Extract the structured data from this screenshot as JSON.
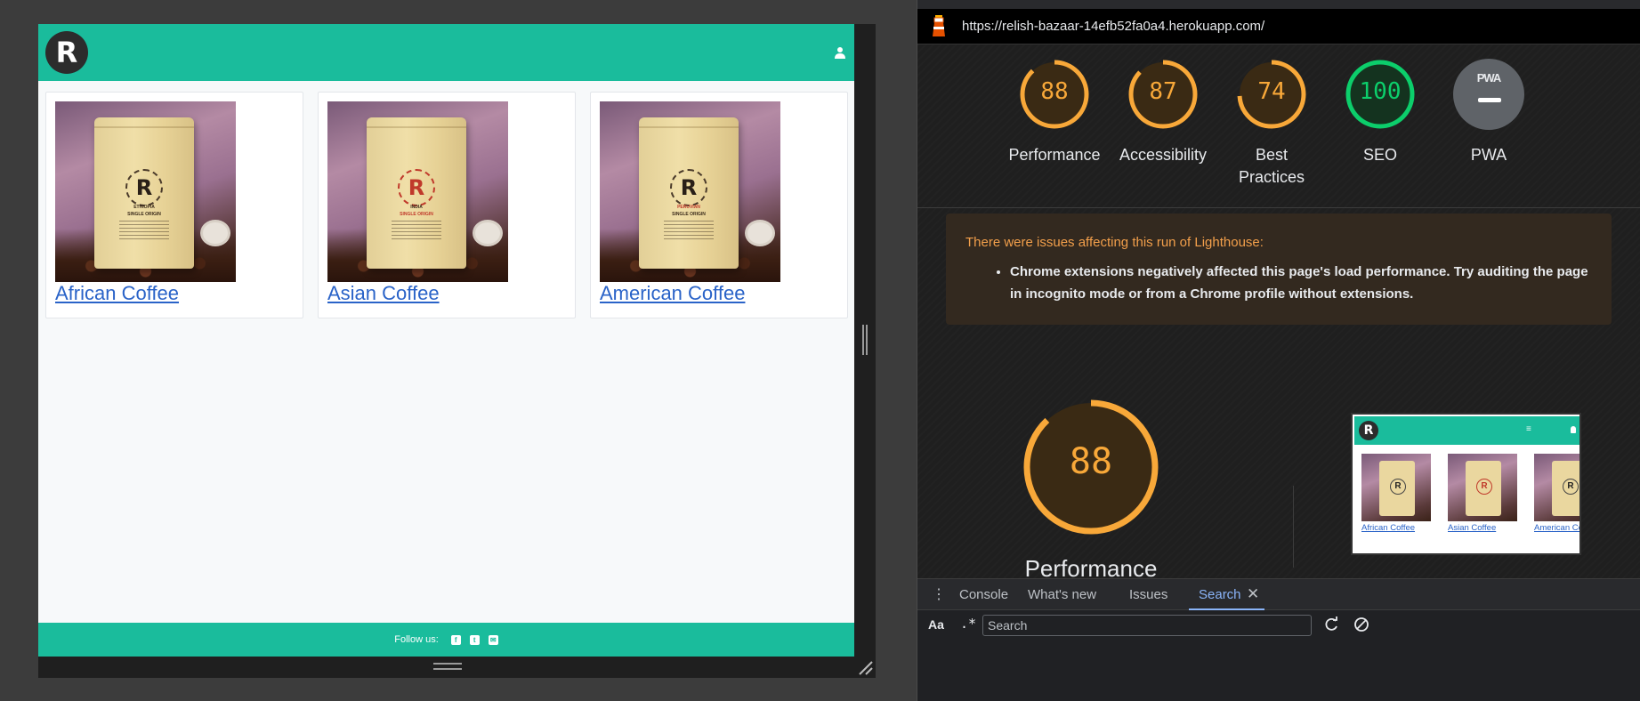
{
  "site": {
    "logo_letter": "R",
    "products": [
      {
        "name": "African Coffee",
        "bag_label": "ETHIOPIA",
        "bag_text": "SINGLE ORIGIN",
        "accent": "#3a2a1a"
      },
      {
        "name": "Asian Coffee",
        "bag_label": "INDIA",
        "bag_text": "SINGLE ORIGIN",
        "accent": "#c0392b"
      },
      {
        "name": "American Coffee",
        "bag_label": "PERUVIAN",
        "bag_text": "SINGLE ORIGIN",
        "accent": "#3a2a1a"
      }
    ],
    "footer": {
      "follow_label": "Follow us:",
      "social_icons": [
        "facebook-icon",
        "twitter-icon",
        "email-icon"
      ]
    },
    "brand_color": "#1abc9c"
  },
  "devtools": {
    "url": "https://relish-bazaar-14efb52fa0a4.herokuapp.com/",
    "scores": [
      {
        "label": "Performance",
        "value": 88,
        "color": "#f8a839"
      },
      {
        "label": "Accessibility",
        "value": 87,
        "color": "#f8a839"
      },
      {
        "label": "Best Practices",
        "value": 74,
        "color": "#f8a839"
      },
      {
        "label": "SEO",
        "value": 100,
        "color": "#0cce6b"
      }
    ],
    "pwa": {
      "label": "PWA",
      "badge_text": "PWA"
    },
    "warning": {
      "title": "There were issues affecting this run of Lighthouse:",
      "item": "Chrome extensions negatively affected this page's load performance. Try auditing the page in incognito mode or from a Chrome profile without extensions."
    },
    "main_score": {
      "value": 88,
      "label": "Performance"
    },
    "preview": {
      "links": [
        "African Coffee",
        "Asian Coffee",
        "American Coffee"
      ],
      "logo_letter": "R",
      "menu_glyph": "≡"
    },
    "drawer_tabs": [
      {
        "label": "Console",
        "active": false
      },
      {
        "label": "What's new",
        "active": false
      },
      {
        "label": "Issues",
        "active": false
      },
      {
        "label": "Search",
        "active": true
      }
    ],
    "search": {
      "match_case_label": "Aa",
      "regex_label": ".*",
      "placeholder": "Search"
    }
  }
}
